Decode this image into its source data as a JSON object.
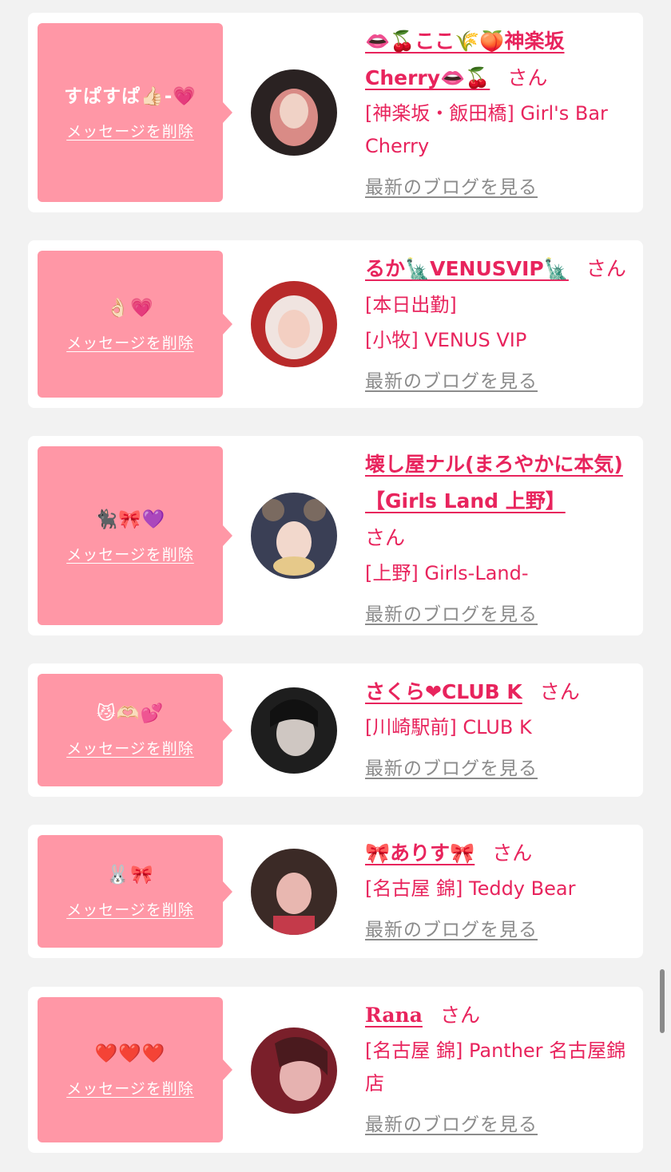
{
  "cards": [
    {
      "message": "すぱすぱ👍🏻-💗",
      "delete_label": "メッセージを削除",
      "name": "👄🍒ここ🌾🍑神楽坂Cherry👄🍒",
      "honorific": "さん",
      "status": "",
      "shop": "[神楽坂・飯田橋] Girl's Bar Cherry",
      "blog_label": "最新のブログを見る"
    },
    {
      "message": "👌🏻💗",
      "delete_label": "メッセージを削除",
      "name": "るか🗽VENUSVIP🗽",
      "honorific": "さん",
      "status": "[本日出勤]",
      "shop": "[小牧] VENUS VIP",
      "blog_label": "最新のブログを見る"
    },
    {
      "message": "🐈‍⬛🎀💜",
      "delete_label": "メッセージを削除",
      "name": "壊し屋ナル(まろやかに本気)【Girls Land 上野】",
      "honorific": "さん",
      "status": "",
      "shop": "[上野] Girls-Land-",
      "blog_label": "最新のブログを見る"
    },
    {
      "message": "😼🫶🏻💕",
      "delete_label": "メッセージを削除",
      "name": "さくら❤CLUB K",
      "honorific": "さん",
      "status": "",
      "shop": "[川崎駅前] CLUB K",
      "blog_label": "最新のブログを見る"
    },
    {
      "message": "🐰🎀",
      "delete_label": "メッセージを削除",
      "name": "🎀ありす🎀",
      "honorific": "さん",
      "status": "",
      "shop": "[名古屋 錦] Teddy Bear",
      "blog_label": "最新のブログを見る"
    },
    {
      "message": "❤️❤️❤️",
      "delete_label": "メッセージを削除",
      "name": "Rana",
      "honorific": "さん",
      "status": "",
      "shop": "[名古屋 錦] Panther 名古屋錦店",
      "blog_label": "最新のブログを見る"
    }
  ],
  "avatar_colors": [
    [
      "#2a2222",
      "#d98b86"
    ],
    [
      "#f0e4e0",
      "#b82a2a"
    ],
    [
      "#7a6a60",
      "#3a3f55"
    ],
    [
      "#1e1e1e",
      "#cfc7c2"
    ],
    [
      "#3b2a26",
      "#e8b7b0"
    ],
    [
      "#7a1f2a",
      "#e6b2b0"
    ]
  ],
  "colors": {
    "accent": "#e8245d",
    "bubble": "#ff97a6",
    "link_gray": "#8b8b8b",
    "background": "#f2f2f2"
  }
}
